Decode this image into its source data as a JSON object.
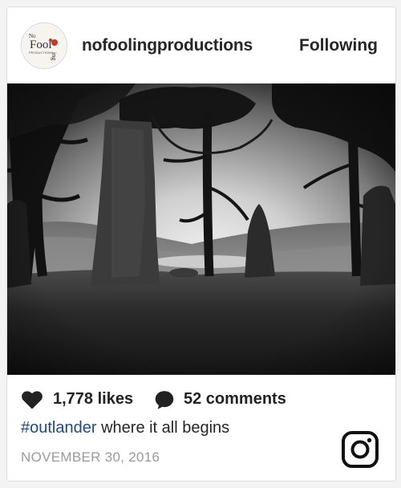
{
  "post": {
    "username": "nofoolingproductions",
    "follow_label": "Following",
    "likes_text": "1,778 likes",
    "comments_text": "52 comments",
    "caption": {
      "hashtag": "#outlander",
      "text": " where it all begins"
    },
    "date": "NOVEMBER 30, 2016"
  },
  "avatar_logo": {
    "top_text": "No",
    "word": "Fool",
    "sub_text": "PRODUCTIONS",
    "side_text": "ing"
  },
  "icons": {
    "likes": "heart-icon",
    "comments": "speech-bubble-icon",
    "brand": "instagram-icon"
  },
  "colors": {
    "text": "#262626",
    "hashtag": "#1f4a82",
    "date": "#9a9a9a",
    "logo_red": "#c0392b"
  }
}
